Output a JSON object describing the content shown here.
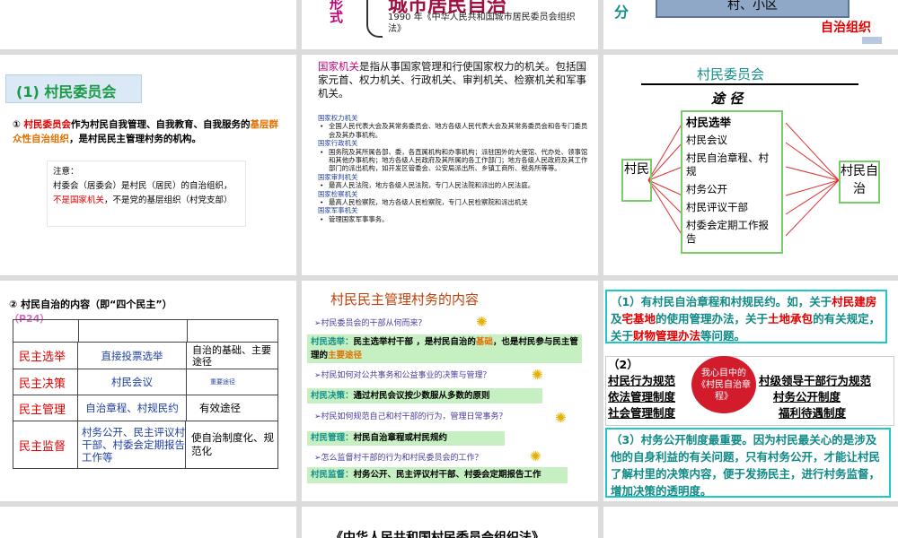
{
  "s1": {
    "title": "城市居民自治",
    "xing_label": "形式",
    "law": "1990 年《中华人民共和国城市居民委员会组织法》"
  },
  "s3": {
    "fen": "分",
    "box": "村、小区",
    "zizhi": "自治组织"
  },
  "s4": {
    "title": "(1) 村民委员会",
    "p_num": "①",
    "p_red": "村民委员会",
    "p_a": "作为村民自我管理、自我教育、自我服务的",
    "p_orange": "基层群众性自治组织",
    "p_b": "，是村民民主管理村务的机构。",
    "note_label": "注意：",
    "note_line1": "村委会（居委会）是村民（居民）的自治组织，",
    "note_line2_red": "不是国家机关",
    "note_line2_rest": "，不是党的基层组织（村党支部）"
  },
  "s5": {
    "intro_red": "国家机关",
    "intro_rest": "是指从事国家管理和行使国家权力的机关。包括国家元首、权力机关、行政机关、审判机关、检察机关和军事机关。",
    "sections": [
      {
        "head": "国家权力机关",
        "body": "全国人民代表大会及其常务委员会、地方各级人民代表大会及其常务委员会和各专门委员会及其办事机构。"
      },
      {
        "head": "国家行政机关",
        "body": "国务院及其所属各部、委，各直属机构和办事机构；派驻国外的大使馆、代办处、领事馆和其他办事机构；地方各级人民政府及其所属的各工作部门；地方各级人民政府及其工作部门的派出机构，如开发区管委会、公安局派出所、乡镇工商所、税务所等等。"
      },
      {
        "head": "国家审判机关",
        "body": "最高人民法院，地方各级人民法院，专门人民法院和派出的人民法庭。"
      },
      {
        "head": "国家检察机关",
        "body": "最高人民检察院，地方各级人民检察院，专门人民检察院和派出机关"
      },
      {
        "head": "国家军事机关",
        "body": "管理国家军事事务。"
      }
    ]
  },
  "s6": {
    "title": "村民委员会",
    "tujing": "途 径",
    "left": "村民",
    "right": "村民自治",
    "items": [
      "村民选举",
      "村民会议",
      "村民自治章程、村规",
      "村务公开",
      "村民评议干部",
      "村委会定期工作报告"
    ]
  },
  "s7": {
    "title": "② 村民自治的内容（即“四个民主”）",
    "page": "（P24）",
    "rows": [
      {
        "name": "民主选举",
        "way": "直接投票选举",
        "note": "自治的基础、主要途径"
      },
      {
        "name": "民主决策",
        "way": "村民会议",
        "note": "重要途径"
      },
      {
        "name": "民主管理",
        "way": "自治章程、村规民约",
        "note": "有效途径"
      },
      {
        "name": "民主监督",
        "way": "村务公开、民主评议村干部、村委会定期报告工作等",
        "note": "使自治制度化、规范化"
      }
    ]
  },
  "s8": {
    "title": "村民民主管理村务的内容",
    "q1": "➢村民委员会的干部从何而来？",
    "a1_pre": "村民选举：",
    "a1_mid": "民主选举村干部 ，是村民自治的",
    "a1_red": "基础",
    "a1_mid2": "，也是村民参与民主管理的",
    "a1_red2": "主要途径",
    "q2": "➢村民如何对公共事务和公益事业的决策与管理？",
    "a2_pre": "村民决策：",
    "a2": "通过村民会议按少数服从多数的原则",
    "q3": "➢村民如何规范自己和村干部的行为，管理日常事务？",
    "a3_pre": "村民管理：",
    "a3": "村民自治章程或村民规约",
    "q4": "➢怎么监督村干部的行为和村民委员会的工作？",
    "a4_pre": "村民监督：",
    "a4": "村务公开、民主评议村干部、村委会定期报告工作"
  },
  "s9": {
    "p1_a": "（1）有村民自治章程和村规民约。如，关于",
    "p1_r1": "村民建房",
    "p1_b": "及",
    "p1_r2": "宅基地",
    "p1_c": "的使用管理办法，关于",
    "p1_r3": "土地承包",
    "p1_d": "的有关规定，关于",
    "p1_r4": "财物管理办法",
    "p1_e": "等问题。",
    "p2_num": "（2）",
    "left_items": [
      "村民行为规范",
      "依法管理制度",
      "社会管理制度"
    ],
    "right_items": [
      "村级领导干部行为规范",
      "村务公开制度",
      "福利待遇制度"
    ],
    "circle": "我心目中的《村民自治章程》",
    "p3": "（3）村务公开制度最重要。因为村民最关心的是涉及他的自身利益的有关问题，只有村务公开，才能让村民了解村里的决策内容，便于发扬民主，进行村务监督，增加决策的透明度。"
  },
  "s11": {
    "title": "《中华人民共和国村民委员会组织法》"
  }
}
